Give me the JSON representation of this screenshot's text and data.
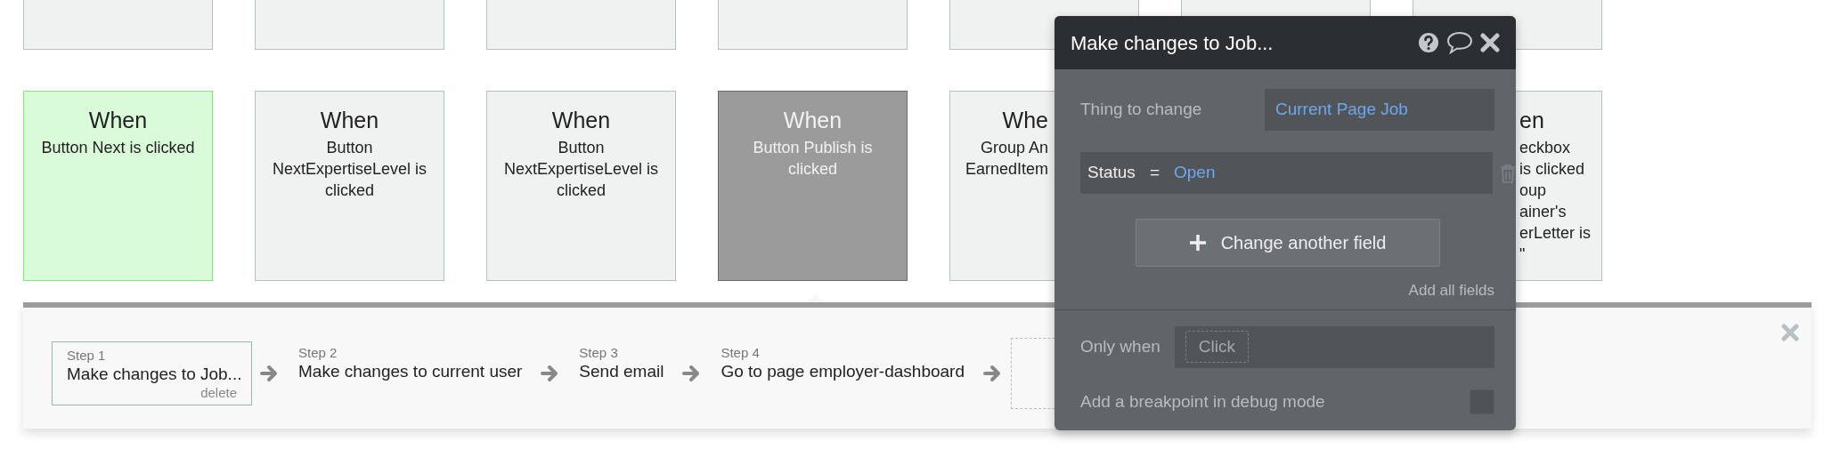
{
  "cards": [
    {
      "kind": "full",
      "title": "When",
      "lines": [
        "Button Next is clicked"
      ],
      "color": "#dafbd9",
      "selected": false
    },
    {
      "kind": "full",
      "title": "When",
      "lines": [
        "Button",
        "NextExpertiseLevel is",
        "clicked"
      ],
      "color": "#f0f1f1",
      "selected": false
    },
    {
      "kind": "full",
      "title": "When",
      "lines": [
        "Button",
        "NextExpertiseLevel is",
        "clicked"
      ],
      "color": "#f0f1f1",
      "selected": false
    },
    {
      "kind": "full",
      "title": "When",
      "lines": [
        "Button Publish is",
        "clicked"
      ],
      "color": "#9b9b9b",
      "selected": true
    },
    {
      "kind": "clipped-right",
      "title": "Whe",
      "lines": [
        "Group An",
        "EarnedItem"
      ],
      "color": "#f0f1f1",
      "selected": false
    },
    {
      "kind": "clipped-left",
      "title": "en",
      "lines": [
        "eckbox",
        "is clicked",
        "oup",
        "ainer's",
        "erLetter is",
        "\""
      ],
      "color": "#f0f1f1",
      "selected": false
    }
  ],
  "workflow": {
    "steps": [
      {
        "label": "Step 1",
        "action": "Make changes to Job...",
        "delete": "delete",
        "selected": true
      },
      {
        "label": "Step 2",
        "action": "Make changes to current user",
        "selected": false
      },
      {
        "label": "Step 3",
        "action": "Send email",
        "selected": false
      },
      {
        "label": "Step 4",
        "action": "Go to page employer-dashboard",
        "selected": false
      }
    ]
  },
  "popup": {
    "title": "Make changes to Job...",
    "thing_label": "Thing to change",
    "thing_value": "Current Page Job",
    "fields": [
      {
        "name": "Status",
        "operator": "=",
        "value": "Open"
      }
    ],
    "add_button": "Change another field",
    "add_all": "Add all fields",
    "only_when_label": "Only when",
    "only_when_placeholder": "Click",
    "breakpoint_label": "Add a breakpoint in debug mode",
    "breakpoint_checked": false
  }
}
